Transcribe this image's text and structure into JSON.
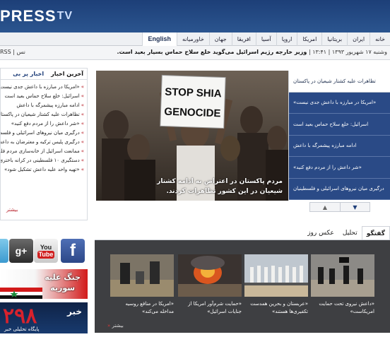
{
  "header": {
    "logo_main": "PRESS",
    "logo_tv": "TV"
  },
  "nav": {
    "items": [
      "خانه",
      "ایران",
      "بریتانیا",
      "امریکا",
      "اروپا",
      "آسیا",
      "افریقا",
      "جهان",
      "خاورمیانه",
      "English"
    ]
  },
  "ticker": {
    "rss": "RSS | نس",
    "date": "وشنبه ۱۷ شهریور ۱۳۹۳ | ۱۳:۴۱ |",
    "headline": "وزیر خارجه رژیم اسرائیل می‌گوید خلع سلاح حماس بسیار بعید است."
  },
  "latest": {
    "tab_latest": "آخرین اخبار",
    "tab_popular": "اخبار پر بی",
    "items": [
      "«امریکا در مبارزه با داعش جدی نیست»",
      "اسرائیل: خلع سلاح حماس بعید است",
      "ادامه مبارزه پیشمرگه با داعش",
      "تظاهرات علیه کشتار شیعیان در پاکستان",
      "«شر داعش را از مردم دفع کنید»",
      "درگیری میان نیروهای اسرائیلی و فلسطینی",
      "درگیری پلیس ترکیه و معترضان به داعش",
      "ممانعت اسرائیل از خانه‌سازی مردم فلسطین",
      "دستگیری ۱۰ فلسطینی در کرانه باختری",
      "«تهیه واحد علیه داعش تشکیل شود»"
    ],
    "more": "بیشتر"
  },
  "slider": {
    "sign_line1": "STOP SHIA",
    "sign_line2": "GENOCIDE",
    "caption": "مردم پاکستان در اعتراض به ادامه کشتار شیعیان در این کشور تظاهرات کردند."
  },
  "headlines": [
    "تظاهرات علیه کشتار شیعیان در پاکستان",
    "«امریکا در مبارزه با داعش جدی نیست»",
    "اسرائیل: خلع سلاح حماس بعید است",
    "ادامه مبارزه پیشمرگه با داعش",
    "«شر داعش را از مردم دفع کنید»",
    "درگیری میان نیروهای اسرائیلی و فلسطینیان"
  ],
  "social": {
    "gplus": "g+",
    "youtube_you": "You",
    "youtube_tube": "Tube",
    "facebook": "f"
  },
  "banners": {
    "war_line1": "جنگ علیه",
    "war_line2": "سوریه",
    "khabar_big": "۲۹۸",
    "khabar_word": "خبر",
    "khabar_small": "پایگاه تحلیلی خبر"
  },
  "tabs": [
    "گفتگو",
    "تحلیل",
    "عکس روز"
  ],
  "videos": [
    {
      "caption": "«داعش نیروی تحت حمایت امریکاست»"
    },
    {
      "caption": "«عربستان و بحرین همدست تکفیری‌ها هستند»"
    },
    {
      "caption": "«حمایت شرم‌آور امریکا از جنایات اسرائیل»"
    },
    {
      "caption": "«امریکا در منافع روسیه مداخله می‌کند»"
    }
  ],
  "gallery_more": "بیشتر",
  "colors": {
    "header_blue": "#1d3f78",
    "headline_blue": "#2a4a86",
    "accent_red": "#b8202a",
    "gallery_bg": "#3e3f42"
  }
}
